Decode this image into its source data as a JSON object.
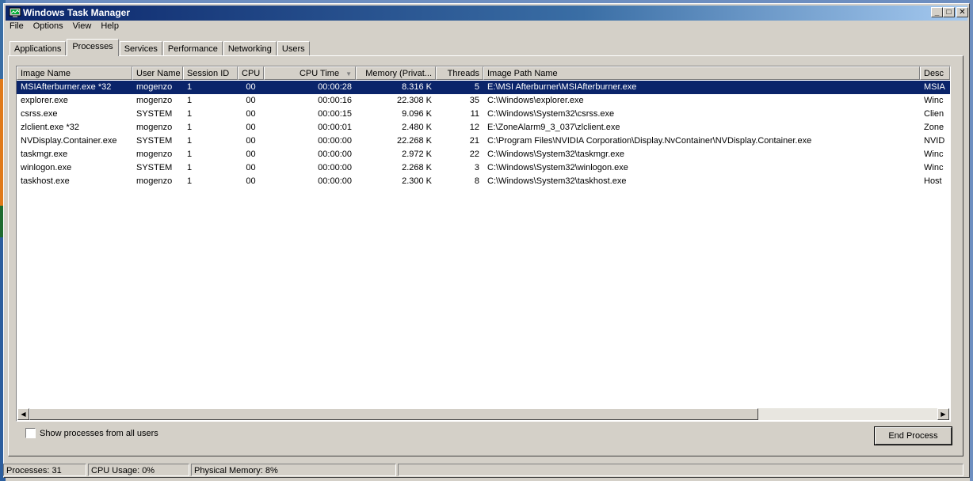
{
  "window": {
    "title": "Windows Task Manager",
    "controls": {
      "minimize": "_",
      "maximize": "□",
      "close": "✕"
    }
  },
  "menu": [
    "File",
    "Options",
    "View",
    "Help"
  ],
  "tabs": [
    {
      "label": "Applications",
      "active": false
    },
    {
      "label": "Processes",
      "active": true
    },
    {
      "label": "Services",
      "active": false
    },
    {
      "label": "Performance",
      "active": false
    },
    {
      "label": "Networking",
      "active": false
    },
    {
      "label": "Users",
      "active": false
    }
  ],
  "columns": [
    {
      "label": "Image Name"
    },
    {
      "label": "User Name"
    },
    {
      "label": "Session ID"
    },
    {
      "label": "CPU"
    },
    {
      "label": "CPU Time",
      "sorted": true
    },
    {
      "label": "Memory (Privat..."
    },
    {
      "label": "Threads"
    },
    {
      "label": "Image Path Name"
    },
    {
      "label": "Desc"
    }
  ],
  "processes": [
    [
      "MSIAfterburner.exe *32",
      "mogenzo",
      "1",
      "00",
      "00:00:28",
      "8.316 K",
      "5",
      "E:\\MSI Afterburner\\MSIAfterburner.exe",
      "MSIA"
    ],
    [
      "explorer.exe",
      "mogenzo",
      "1",
      "00",
      "00:00:16",
      "22.308 K",
      "35",
      "C:\\Windows\\explorer.exe",
      "Winc"
    ],
    [
      "csrss.exe",
      "SYSTEM",
      "1",
      "00",
      "00:00:15",
      "9.096 K",
      "11",
      "C:\\Windows\\System32\\csrss.exe",
      "Clien"
    ],
    [
      "zlclient.exe *32",
      "mogenzo",
      "1",
      "00",
      "00:00:01",
      "2.480 K",
      "12",
      "E:\\ZoneAlarm9_3_037\\zlclient.exe",
      "Zone"
    ],
    [
      "NVDisplay.Container.exe",
      "SYSTEM",
      "1",
      "00",
      "00:00:00",
      "22.268 K",
      "21",
      "C:\\Program Files\\NVIDIA Corporation\\Display.NvContainer\\NVDisplay.Container.exe",
      "NVID"
    ],
    [
      "taskmgr.exe",
      "mogenzo",
      "1",
      "00",
      "00:00:00",
      "2.972 K",
      "22",
      "C:\\Windows\\System32\\taskmgr.exe",
      "Winc"
    ],
    [
      "winlogon.exe",
      "SYSTEM",
      "1",
      "00",
      "00:00:00",
      "2.268 K",
      "3",
      "C:\\Windows\\System32\\winlogon.exe",
      "Winc"
    ],
    [
      "taskhost.exe",
      "mogenzo",
      "1",
      "00",
      "00:00:00",
      "2.300 K",
      "8",
      "C:\\Windows\\System32\\taskhost.exe",
      "Host"
    ]
  ],
  "selected_row": 0,
  "show_all_users_label": "Show processes from all users",
  "end_process_label": "End Process",
  "status": {
    "processes": "Processes: 31",
    "cpu_usage": "CPU Usage: 0%",
    "physical_memory": "Physical Memory: 8%"
  },
  "colors": {
    "titlebar": "#0a246a",
    "selection": "#0a246a",
    "face": "#d4d0c8"
  }
}
